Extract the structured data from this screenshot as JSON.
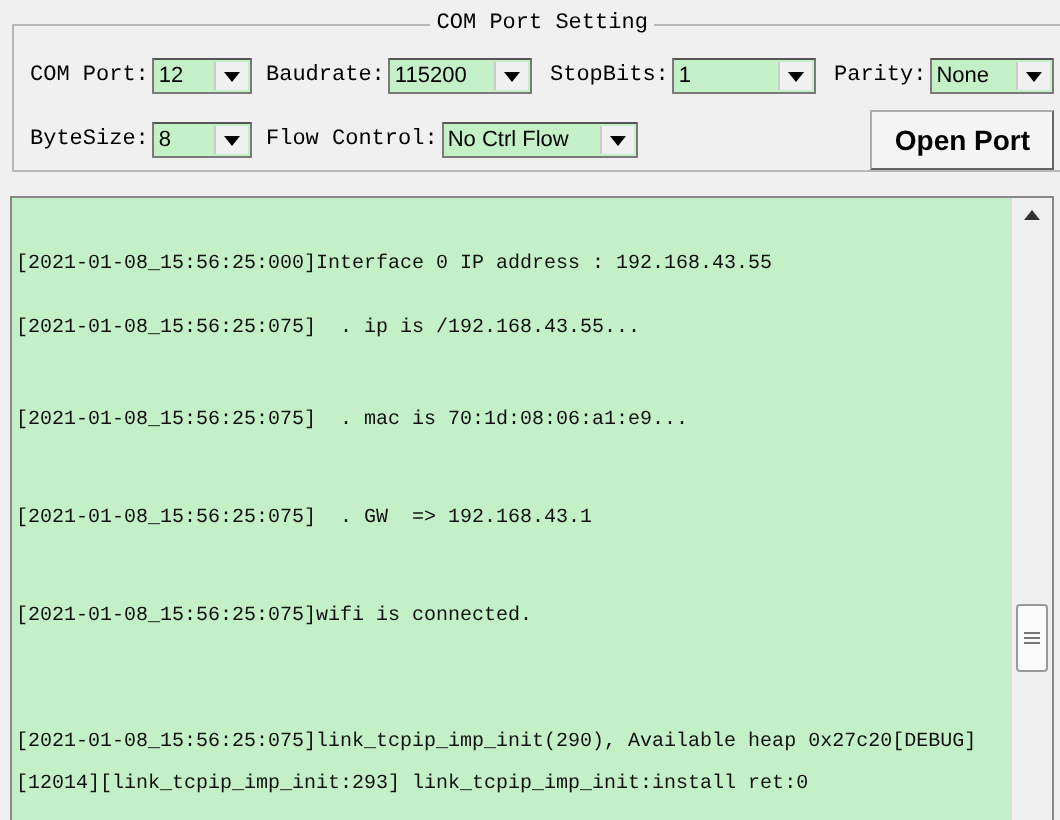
{
  "settings": {
    "title": "COM Port Setting",
    "fields": [
      {
        "label": "COM Port:",
        "value": "12"
      },
      {
        "label": "Baudrate:",
        "value": "115200"
      },
      {
        "label": "StopBits:",
        "value": "1"
      },
      {
        "label": "Parity:",
        "value": "None"
      },
      {
        "label": "ByteSize:",
        "value": "8"
      },
      {
        "label": "Flow Control:",
        "value": "No Ctrl Flow"
      }
    ],
    "button": "Open Port"
  },
  "log": {
    "lines": [
      "[2021-01-08_15:56:25:000]Interface 0 IP address : 192.168.43.55",
      "[2021-01-08_15:56:25:075]  . ip is /192.168.43.55...",
      "[2021-01-08_15:56:25:075]  . mac is 70:1d:08:06:a1:e9...",
      "[2021-01-08_15:56:25:075]  . GW  => 192.168.43.1",
      "[2021-01-08_15:56:25:075]wifi is connected.",
      "[2021-01-08_15:56:25:075]link_tcpip_imp_init(290), Available heap 0x27c20[DEBUG]",
      "[12014][link_tcpip_imp_init:293] link_tcpip_imp_init:install ret:0"
    ]
  }
}
